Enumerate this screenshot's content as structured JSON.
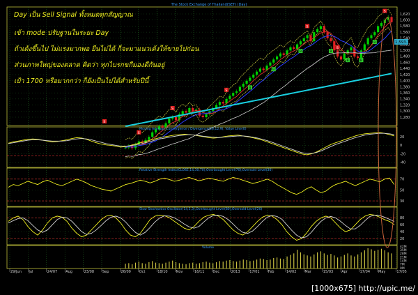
{
  "colors": {
    "background": "#000000",
    "grid": "#2e8b2e",
    "frame": "#bfbf3a",
    "price_candle": "#00d000",
    "price_bear": "#e02020",
    "ma_blue": "#2a3cff",
    "ma_red": "#e03030",
    "ma_white": "#d0d0d0",
    "ma_cyan": "#19d0e0",
    "band": "#cfcf40",
    "ellipse": "#c8643a",
    "annotation_text": "#f0f020",
    "indicator_line": "#f0f020",
    "indicator_line2": "#d0d0d0",
    "oversold_line": "#e03030",
    "title_text": "#3aa0ff",
    "axis_text": "#d0d0d0",
    "volume": "#c8c040",
    "last_price_box": "#2fa8c8",
    "sell_marker": "#e02020",
    "buy_marker": "#2fd02f"
  },
  "watermark": "[1000x675] http://upic.me/",
  "annotations": [
    "Day เป็น Sell Signal ทั้งหมดทุกสัญญาณ",
    "เข้า mode ปรับฐานในระยะ Day",
    "ถ้าเด้งขึ้นไป ไม่แรงมากพอ ยืนไม่ได้ ก็จะมาแนวเด้งให้ขายไปก่อน",
    "ส่วนภาพใหญ่ของตลาด คิดว่า ทุกไบรกขกีมองดีกันอยู่",
    "เป้า 1700 หรือมากกว่า ก็ยังเป็นไปได้สำหรับปีนี้"
  ],
  "chart_data": [
    {
      "type": "line",
      "title": "The Stock Exchange of Thailand(SET) (Day)",
      "price_axis_ticks": [
        "1,620",
        "1,600",
        "1,580",
        "1,560",
        "1,540",
        "1,520",
        "1,500",
        "1,480",
        "1,460",
        "1,440",
        "1,420",
        "1,400",
        "1,380",
        "1,360",
        "1,340",
        "1,320",
        "1,300",
        "1,280"
      ],
      "last_price": "1,593.10",
      "x_tick_labels": [
        "29/Jun",
        "Jul",
        "24/07",
        "Aug",
        "23/08",
        "Sep",
        "26/09",
        "Oct",
        "18/10",
        "Nov",
        "16/11",
        "Dec",
        "2013",
        "17/01",
        "Feb",
        "14/02",
        "Mar",
        "15/03",
        "Apr",
        "17/04",
        "May",
        "17/05"
      ],
      "sell_markers": [
        "S",
        "S",
        "S",
        "S",
        "S",
        "S",
        "S"
      ],
      "buy_markers": [
        "B",
        "B",
        "B",
        "B",
        "B",
        "B",
        "B"
      ],
      "close_series": [
        1180,
        1185,
        1178,
        1190,
        1200,
        1195,
        1205,
        1215,
        1230,
        1240,
        1250,
        1245,
        1260,
        1275,
        1280,
        1270,
        1290,
        1300,
        1295,
        1310,
        1300,
        1305,
        1285,
        1280,
        1290,
        1300,
        1310,
        1320,
        1330,
        1325,
        1340,
        1350,
        1360,
        1365,
        1380,
        1390,
        1400,
        1410,
        1420,
        1430,
        1440,
        1435,
        1450,
        1460,
        1470,
        1480,
        1490,
        1485,
        1500,
        1510,
        1505,
        1520,
        1530,
        1540,
        1550,
        1530,
        1560,
        1570,
        1580,
        1560,
        1540,
        1530,
        1500,
        1480,
        1470,
        1490,
        1500,
        1510,
        1480,
        1475,
        1500,
        1520,
        1540,
        1550,
        1560,
        1580,
        1590,
        1600,
        1610,
        1593
      ]
    },
    {
      "type": "line",
      "title": "Moving Average Convergence / Divergence(26,12,9), Value Line(0)",
      "y_ticks": [
        "20",
        "0",
        "-20",
        "-40"
      ],
      "macd": [
        5,
        8,
        10,
        12,
        14,
        15,
        14,
        12,
        10,
        8,
        9,
        11,
        13,
        16,
        18,
        17,
        14,
        10,
        6,
        3,
        1,
        0,
        -2,
        -4,
        -3,
        0,
        3,
        6,
        9,
        12,
        15,
        18,
        20,
        22,
        24,
        25,
        26,
        25,
        24,
        22,
        20,
        18,
        17,
        18,
        20,
        22,
        23,
        24,
        22,
        20,
        18,
        15,
        12,
        8,
        4,
        0,
        -4,
        -8,
        -12,
        -16,
        -20,
        -22,
        -20,
        -16,
        -10,
        -4,
        2,
        6,
        10,
        14,
        18,
        22,
        25,
        27,
        28,
        29,
        30,
        28,
        25,
        22
      ],
      "signal": [
        4,
        6,
        8,
        10,
        12,
        13,
        13,
        12,
        11,
        10,
        10,
        10,
        11,
        13,
        15,
        16,
        15,
        13,
        10,
        7,
        4,
        2,
        0,
        -2,
        -2,
        -1,
        1,
        3,
        6,
        9,
        12,
        15,
        17,
        19,
        21,
        23,
        24,
        25,
        24,
        23,
        21,
        20,
        19,
        18,
        19,
        20,
        21,
        22,
        22,
        21,
        19,
        17,
        14,
        11,
        7,
        3,
        -1,
        -5,
        -9,
        -13,
        -17,
        -19,
        -19,
        -17,
        -13,
        -8,
        -3,
        2,
        6,
        10,
        14,
        18,
        21,
        24,
        26,
        27,
        28,
        28,
        27,
        25
      ]
    },
    {
      "type": "line",
      "title": "Relative Strength Index(CLOSE,14,30,70),Overbought Level(70),Oversold Level(30)",
      "y_ticks": [
        "70",
        "50",
        "30"
      ],
      "rsi": [
        55,
        60,
        58,
        62,
        66,
        63,
        60,
        65,
        68,
        64,
        60,
        58,
        62,
        66,
        70,
        67,
        63,
        58,
        55,
        52,
        50,
        48,
        52,
        56,
        60,
        62,
        65,
        68,
        66,
        63,
        66,
        70,
        72,
        69,
        66,
        68,
        71,
        73,
        70,
        67,
        69,
        72,
        70,
        68,
        66,
        70,
        73,
        71,
        68,
        65,
        62,
        64,
        67,
        70,
        66,
        60,
        55,
        50,
        45,
        42,
        46,
        52,
        56,
        50,
        45,
        48,
        55,
        60,
        63,
        66,
        62,
        58,
        62,
        66,
        70,
        68,
        65,
        70,
        72,
        60
      ]
    },
    {
      "type": "line",
      "title": "Slow Stochastics Oscillator(14,3,3),Overbought Level(80),Oversold Level(20)",
      "y_ticks": [
        "80",
        "60",
        "40",
        "20"
      ],
      "k": [
        70,
        80,
        85,
        75,
        55,
        40,
        30,
        45,
        65,
        80,
        85,
        82,
        70,
        50,
        35,
        25,
        30,
        45,
        60,
        75,
        85,
        88,
        80,
        65,
        45,
        30,
        25,
        35,
        55,
        75,
        85,
        88,
        86,
        80,
        70,
        60,
        50,
        45,
        55,
        70,
        82,
        88,
        90,
        85,
        75,
        60,
        45,
        35,
        30,
        40,
        55,
        70,
        82,
        88,
        85,
        75,
        60,
        40,
        25,
        15,
        20,
        35,
        55,
        70,
        80,
        85,
        80,
        65,
        50,
        40,
        45,
        60,
        75,
        85,
        90,
        88,
        82,
        75,
        70,
        60
      ],
      "d": [
        65,
        72,
        78,
        80,
        72,
        58,
        45,
        38,
        45,
        60,
        75,
        82,
        80,
        70,
        55,
        40,
        32,
        35,
        45,
        58,
        72,
        82,
        85,
        80,
        68,
        52,
        38,
        30,
        38,
        52,
        68,
        80,
        86,
        85,
        80,
        72,
        62,
        54,
        50,
        55,
        68,
        80,
        87,
        88,
        84,
        75,
        62,
        48,
        38,
        35,
        42,
        55,
        70,
        82,
        87,
        84,
        76,
        60,
        44,
        30,
        22,
        25,
        38,
        55,
        70,
        80,
        84,
        80,
        70,
        58,
        48,
        48,
        58,
        72,
        84,
        88,
        87,
        82,
        76,
        70
      ]
    },
    {
      "type": "bar",
      "title": "Volume",
      "y_ticks": [
        "42M",
        "35M",
        "28M",
        "21M",
        "14M",
        "7M",
        "0M"
      ],
      "values": [
        8,
        9,
        7,
        10,
        12,
        9,
        8,
        11,
        13,
        10,
        9,
        8,
        10,
        12,
        14,
        11,
        9,
        8,
        7,
        9,
        10,
        8,
        9,
        11,
        12,
        10,
        9,
        11,
        13,
        12,
        14,
        15,
        13,
        12,
        14,
        16,
        15,
        13,
        14,
        16,
        18,
        17,
        15,
        16,
        19,
        20,
        18,
        17,
        22,
        25,
        28,
        35,
        30,
        26,
        24,
        22,
        26,
        30,
        32,
        28,
        25,
        27,
        24,
        20,
        22,
        25,
        28,
        24,
        22,
        26,
        30,
        34,
        38,
        36,
        33,
        35,
        37,
        34,
        30,
        28
      ],
      "ylim": [
        0,
        42
      ]
    }
  ]
}
